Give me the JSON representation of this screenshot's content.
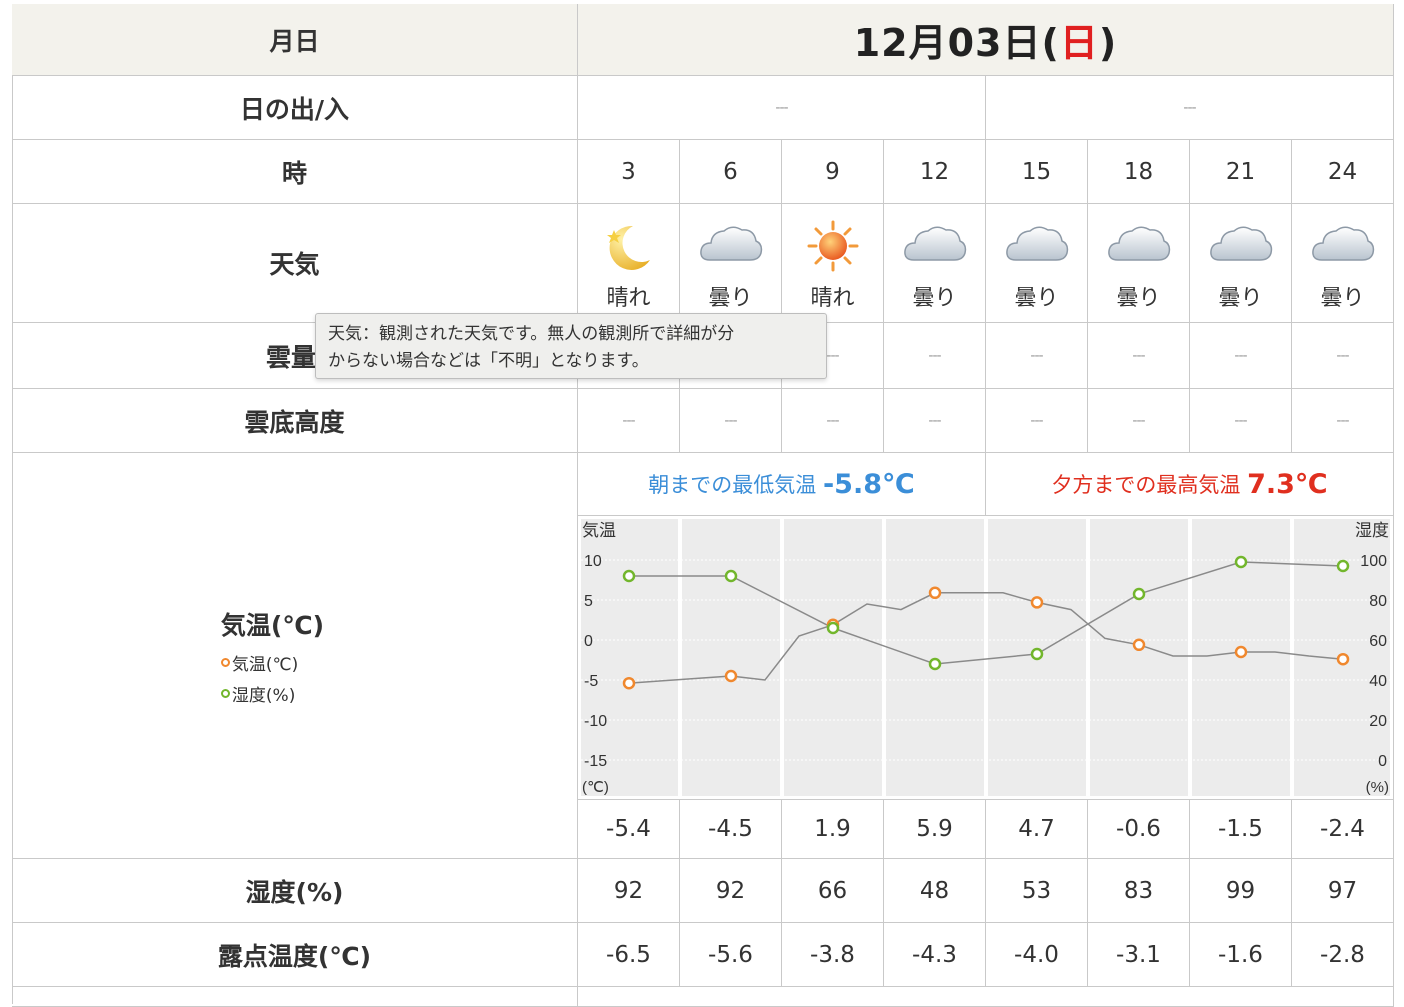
{
  "header": {
    "date_label": "月日",
    "date_main": "12月03日(",
    "date_weekday": "日",
    "date_close": ")"
  },
  "sunrise": {
    "label": "日の出/入",
    "values": [
      "---",
      "---"
    ]
  },
  "time": {
    "label": "時",
    "values": [
      "3",
      "6",
      "9",
      "12",
      "15",
      "18",
      "21",
      "24"
    ]
  },
  "weather": {
    "label": "天気",
    "items": [
      {
        "label": "晴れ",
        "icon": "moon-star-icon"
      },
      {
        "label": "曇り",
        "icon": "cloud-icon"
      },
      {
        "label": "晴れ",
        "icon": "sun-icon"
      },
      {
        "label": "曇り",
        "icon": "cloud-icon"
      },
      {
        "label": "曇り",
        "icon": "cloud-icon"
      },
      {
        "label": "曇り",
        "icon": "cloud-icon"
      },
      {
        "label": "曇り",
        "icon": "cloud-icon"
      },
      {
        "label": "曇り",
        "icon": "cloud-icon"
      }
    ]
  },
  "tooltip": {
    "line1": "天気：観測された天気です。無人の観測所で詳細が分",
    "line2": "からない場合などは「不明」となります。"
  },
  "cloud_amount": {
    "label": "雲量",
    "values": [
      "---",
      "---",
      "---",
      "---",
      "---",
      "---",
      "---",
      "---"
    ]
  },
  "cloud_base": {
    "label": "雲底高度",
    "values": [
      "---",
      "---",
      "---",
      "---",
      "---",
      "---",
      "---",
      "---"
    ]
  },
  "temperature": {
    "label": "気温(℃)",
    "legend_temp": "気温(℃)",
    "legend_humidity": "湿度(%)",
    "min_label": "朝までの最低気温",
    "min_value": "-5.8℃",
    "max_label": "夕方までの最高気温",
    "max_value": "7.3℃",
    "values": [
      "-5.4",
      "-4.5",
      "1.9",
      "5.9",
      "4.7",
      "-0.6",
      "-1.5",
      "-2.4"
    ]
  },
  "chart_data": {
    "type": "line",
    "x": [
      3,
      6,
      9,
      12,
      15,
      18,
      21,
      24
    ],
    "series": [
      {
        "name": "気温(℃)",
        "axis": "left",
        "values": [
          -5.4,
          -4.5,
          1.9,
          5.9,
          4.7,
          -0.6,
          -1.5,
          -2.4
        ],
        "color": "#f0882e",
        "hourly_line": [
          -5.4,
          -5.1,
          -4.8,
          -4.5,
          -5.0,
          0.5,
          1.9,
          4.5,
          3.8,
          5.9,
          5.9,
          5.9,
          4.7,
          3.8,
          0.2,
          -0.6,
          -2.0,
          -2.0,
          -1.5,
          -1.5,
          -2.0,
          -2.4
        ]
      },
      {
        "name": "湿度(%)",
        "axis": "right",
        "values": [
          92,
          92,
          66,
          48,
          53,
          83,
          99,
          97
        ],
        "color": "#72b62c"
      }
    ],
    "left_axis": {
      "title": "気温",
      "unit": "(℃)",
      "ticks": [
        "10",
        "5",
        "0",
        "-5",
        "-10",
        "-15"
      ],
      "range": [
        -15,
        10
      ]
    },
    "right_axis": {
      "title": "湿度",
      "unit": "(%)",
      "ticks": [
        "100",
        "80",
        "60",
        "40",
        "20",
        "0"
      ],
      "range": [
        0,
        100
      ]
    },
    "grid": true,
    "line_color": "#8a8a8a"
  },
  "humidity": {
    "label": "湿度(%)",
    "values": [
      "92",
      "92",
      "66",
      "48",
      "53",
      "83",
      "99",
      "97"
    ]
  },
  "dewpoint": {
    "label": "露点温度(℃)",
    "values": [
      "-6.5",
      "-5.6",
      "-3.8",
      "-4.3",
      "-4.0",
      "-3.1",
      "-1.6",
      "-2.8"
    ]
  },
  "colors": {
    "header_bg": "#f3f2ec",
    "border": "#c9c9c9",
    "min_blue": "#3b8ed8",
    "max_red": "#e02f1f",
    "sunday_red": "#e02020"
  }
}
